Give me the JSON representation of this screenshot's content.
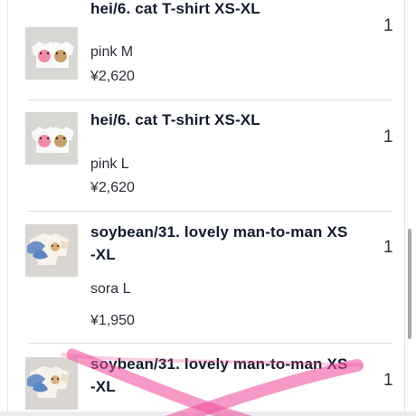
{
  "items": [
    {
      "title": "hei/6. cat T-shirt XS-XL",
      "variant": "pink M",
      "price": "¥2,620",
      "quantity": "1",
      "thumbnail_icon": "cat-tshirt-thumbnail"
    },
    {
      "title": "hei/6. cat T-shirt XS-XL",
      "variant": "pink L",
      "price": "¥2,620",
      "quantity": "1",
      "thumbnail_icon": "cat-tshirt-thumbnail"
    },
    {
      "title": "soybean/31. lovely man-to-man XS\n-XL",
      "variant": "sora L",
      "price": "¥1,950",
      "quantity": "1",
      "thumbnail_icon": "man-to-man-thumbnail"
    },
    {
      "title": "soybean/31. lovely man-to-man XS\n-XL",
      "quantity": "1",
      "thumbnail_icon": "man-to-man-thumbnail"
    }
  ],
  "colors": {
    "title_text": "#111a2e",
    "body_text": "#2b2f39",
    "divider": "#dedee2",
    "watermark_pink": "#f04f9c"
  }
}
